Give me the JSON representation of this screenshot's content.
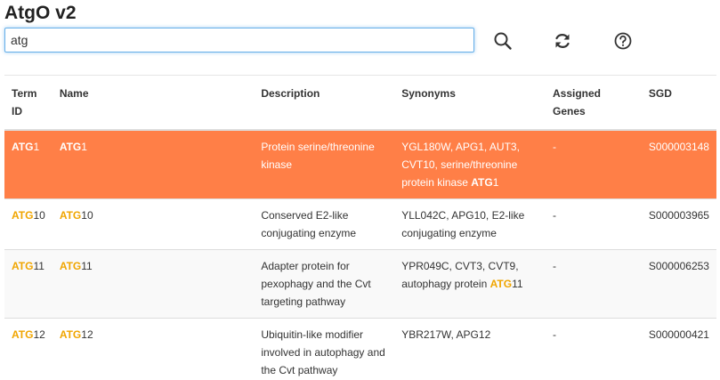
{
  "app": {
    "title": "AtgO v2"
  },
  "search": {
    "value": "atg",
    "highlight": "ATG"
  },
  "toolbar": {
    "search_icon": "search-icon",
    "refresh_icon": "refresh-icon",
    "help_icon": "help-circle-icon"
  },
  "colors": {
    "selected_row": "#ff7f47",
    "highlight_text": "#f0a500",
    "input_focus_border": "#66afe9"
  },
  "table": {
    "headers": {
      "term_id": "Term ID",
      "name": "Name",
      "description": "Description",
      "synonyms": "Synonyms",
      "assigned_genes": "Assigned Genes",
      "sgd": "SGD"
    },
    "rows": [
      {
        "term_id": {
          "hl": "ATG",
          "rest": "1"
        },
        "name": {
          "hl": "ATG",
          "rest": "1"
        },
        "description": "Protein serine/threonine kinase",
        "synonyms": {
          "pre": "YGL180W, APG1, AUT3, CVT10, serine/threonine protein kinase ",
          "hl": "ATG",
          "post": "1"
        },
        "assigned_genes": "-",
        "sgd": "S000003148",
        "selected": true
      },
      {
        "term_id": {
          "hl": "ATG",
          "rest": "10"
        },
        "name": {
          "hl": "ATG",
          "rest": "10"
        },
        "description": "Conserved E2-like conjugating enzyme",
        "synonyms": {
          "pre": "YLL042C, APG10, E2-like conjugating enzyme",
          "hl": "",
          "post": ""
        },
        "assigned_genes": "-",
        "sgd": "S000003965",
        "selected": false
      },
      {
        "term_id": {
          "hl": "ATG",
          "rest": "11"
        },
        "name": {
          "hl": "ATG",
          "rest": "11"
        },
        "description": "Adapter protein for pexophagy and the Cvt targeting pathway",
        "synonyms": {
          "pre": "YPR049C, CVT3, CVT9, autophagy protein ",
          "hl": "ATG",
          "post": "11"
        },
        "assigned_genes": "-",
        "sgd": "S000006253",
        "selected": false
      },
      {
        "term_id": {
          "hl": "ATG",
          "rest": "12"
        },
        "name": {
          "hl": "ATG",
          "rest": "12"
        },
        "description": "Ubiquitin-like modifier involved in autophagy and the Cvt pathway",
        "synonyms": {
          "pre": "YBR217W, APG12",
          "hl": "",
          "post": ""
        },
        "assigned_genes": "-",
        "sgd": "S000000421",
        "selected": false
      }
    ]
  }
}
